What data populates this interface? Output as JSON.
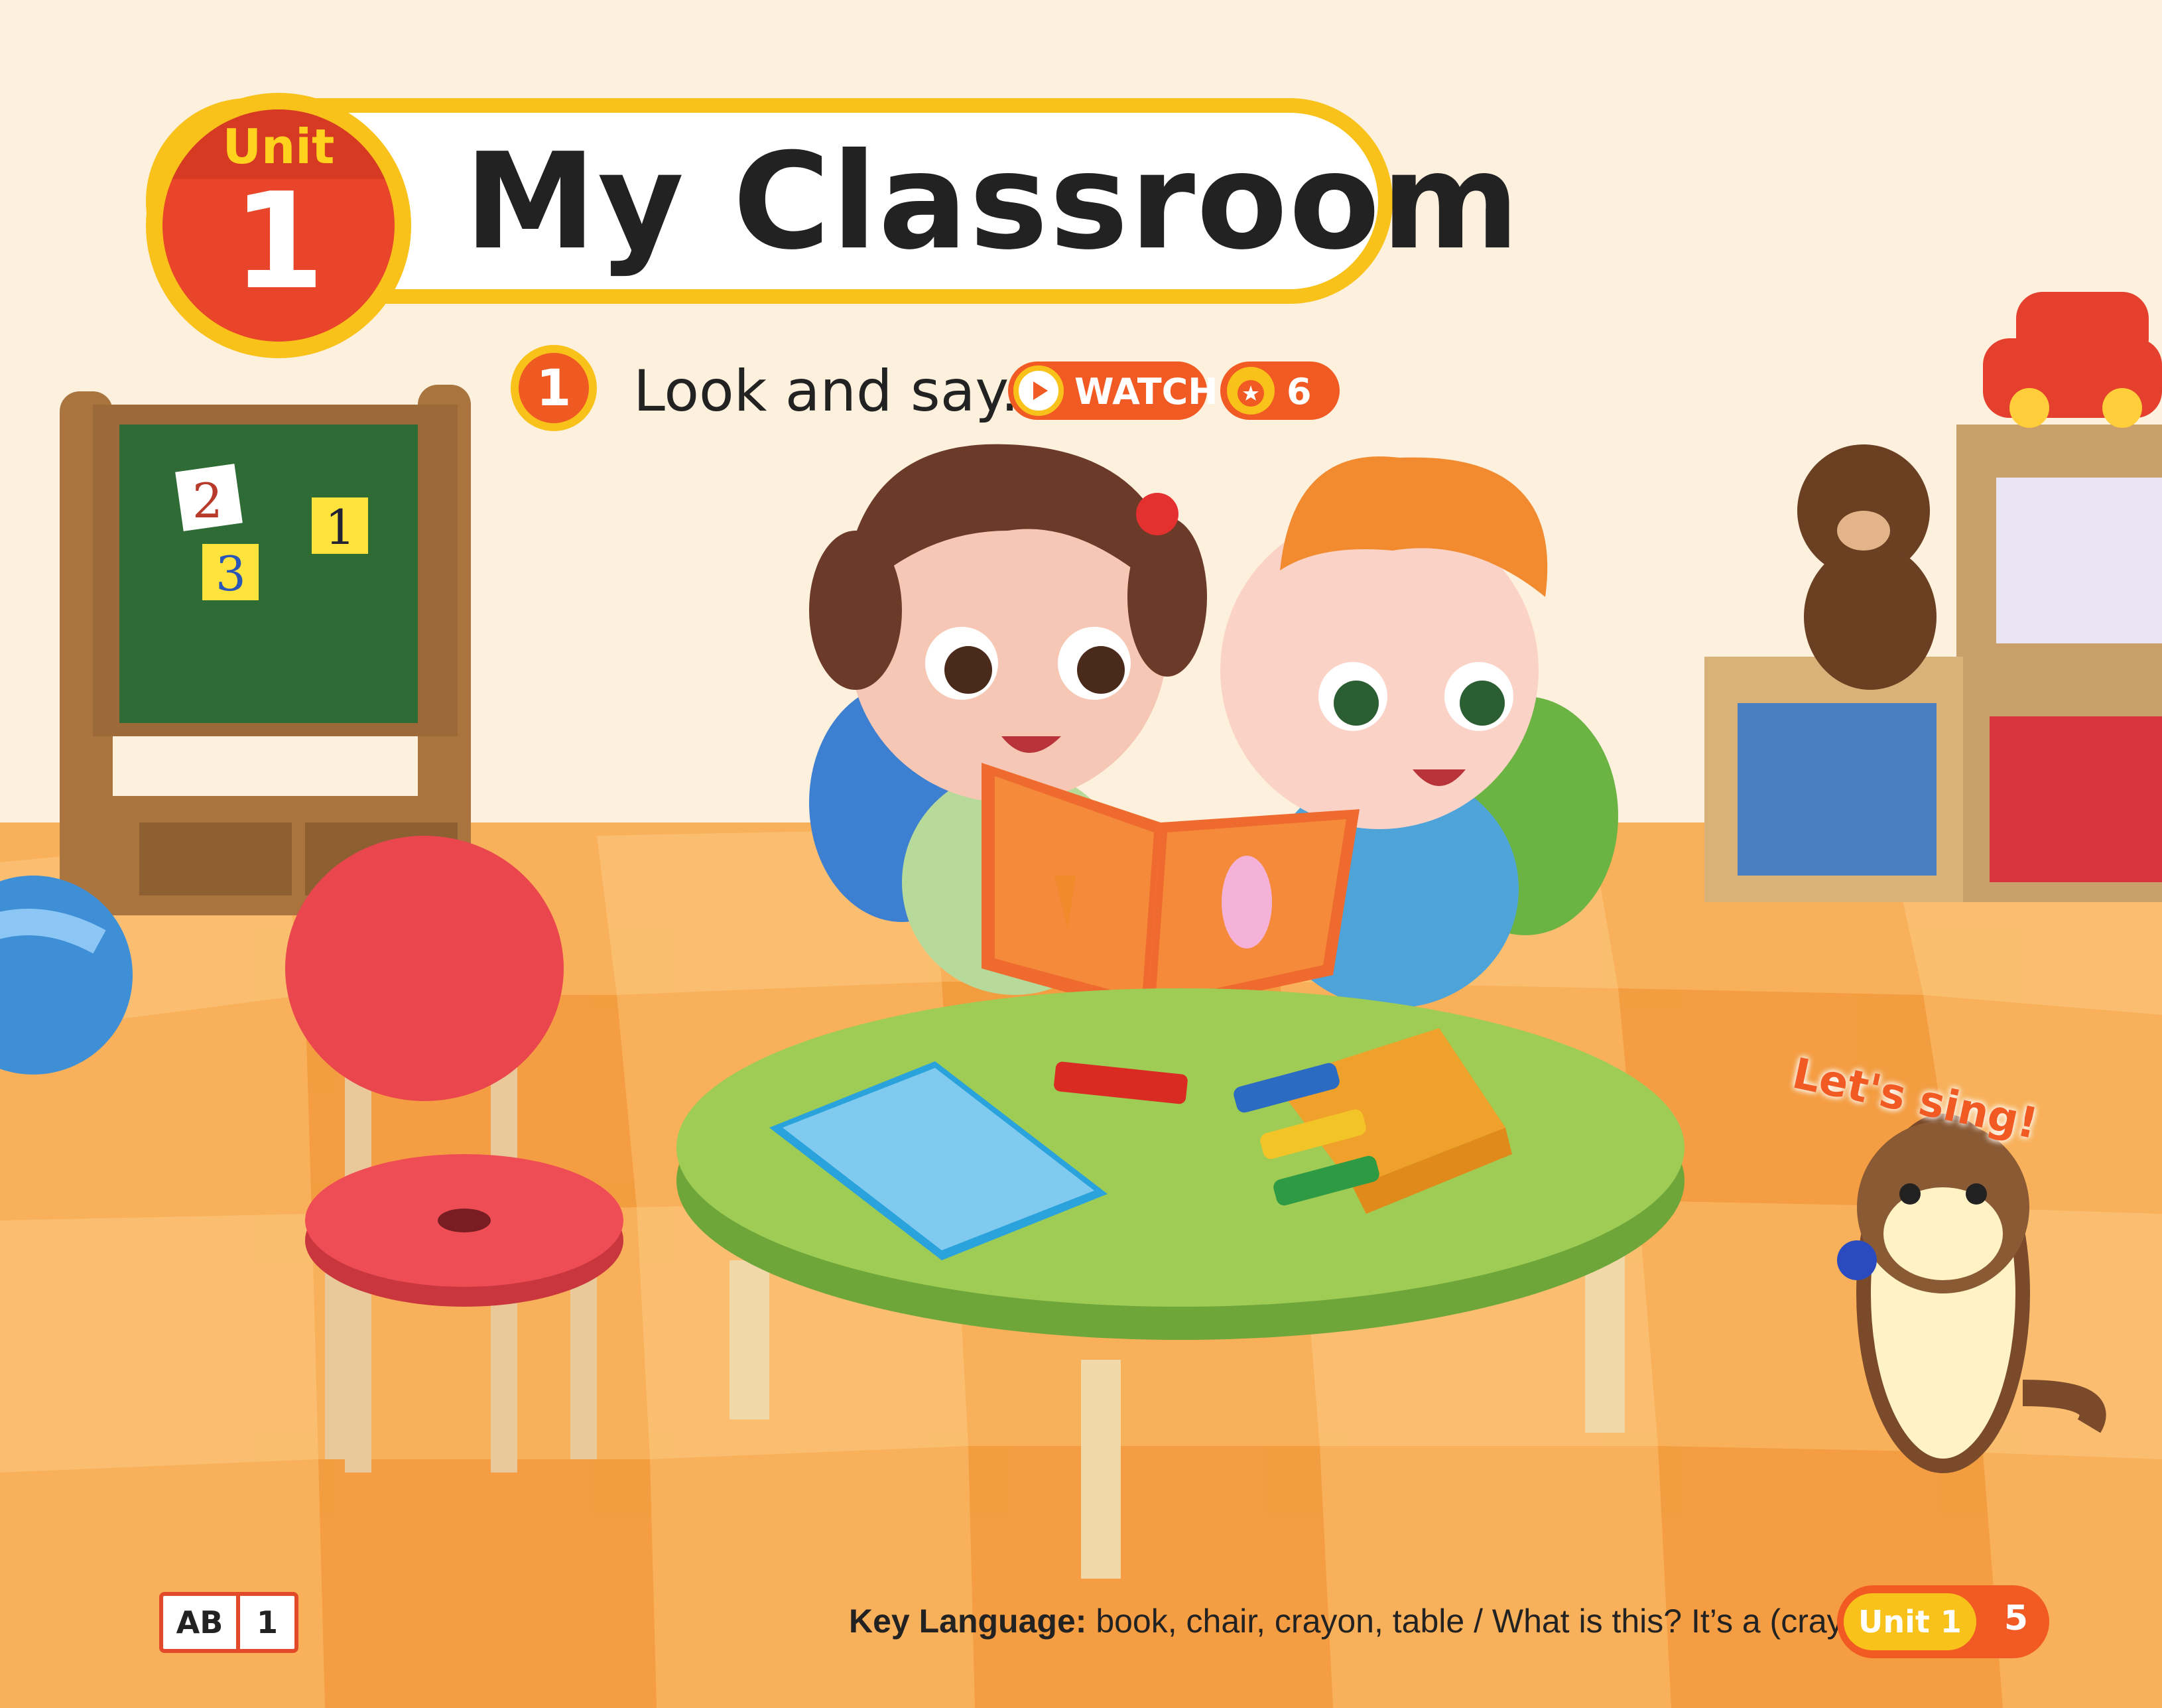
{
  "unit": {
    "label": "Unit",
    "number": "1",
    "title": "My Classroom"
  },
  "activity": {
    "number": "1",
    "instruction": "Look and say.",
    "watch_label": "WATCH",
    "track_number": "6"
  },
  "illustration": {
    "blocks": [
      "2",
      "1",
      "3"
    ],
    "sing_label": "Let's sing!"
  },
  "footer": {
    "ab_label": "AB",
    "ab_number": "1",
    "key_language_label": "Key Language:",
    "key_language_text": "book, chair, crayon, table / What is this? It’s a (crayon).",
    "unit_tab_label": "Unit 1",
    "page_number": "5"
  },
  "colors": {
    "accent_yellow": "#f9c21a",
    "accent_orange": "#f15a22",
    "unit_red": "#e8452a",
    "wall": "#fdf0dd",
    "floor": "#f7a54a"
  },
  "icons": [
    "play-icon",
    "music-track-icon"
  ]
}
